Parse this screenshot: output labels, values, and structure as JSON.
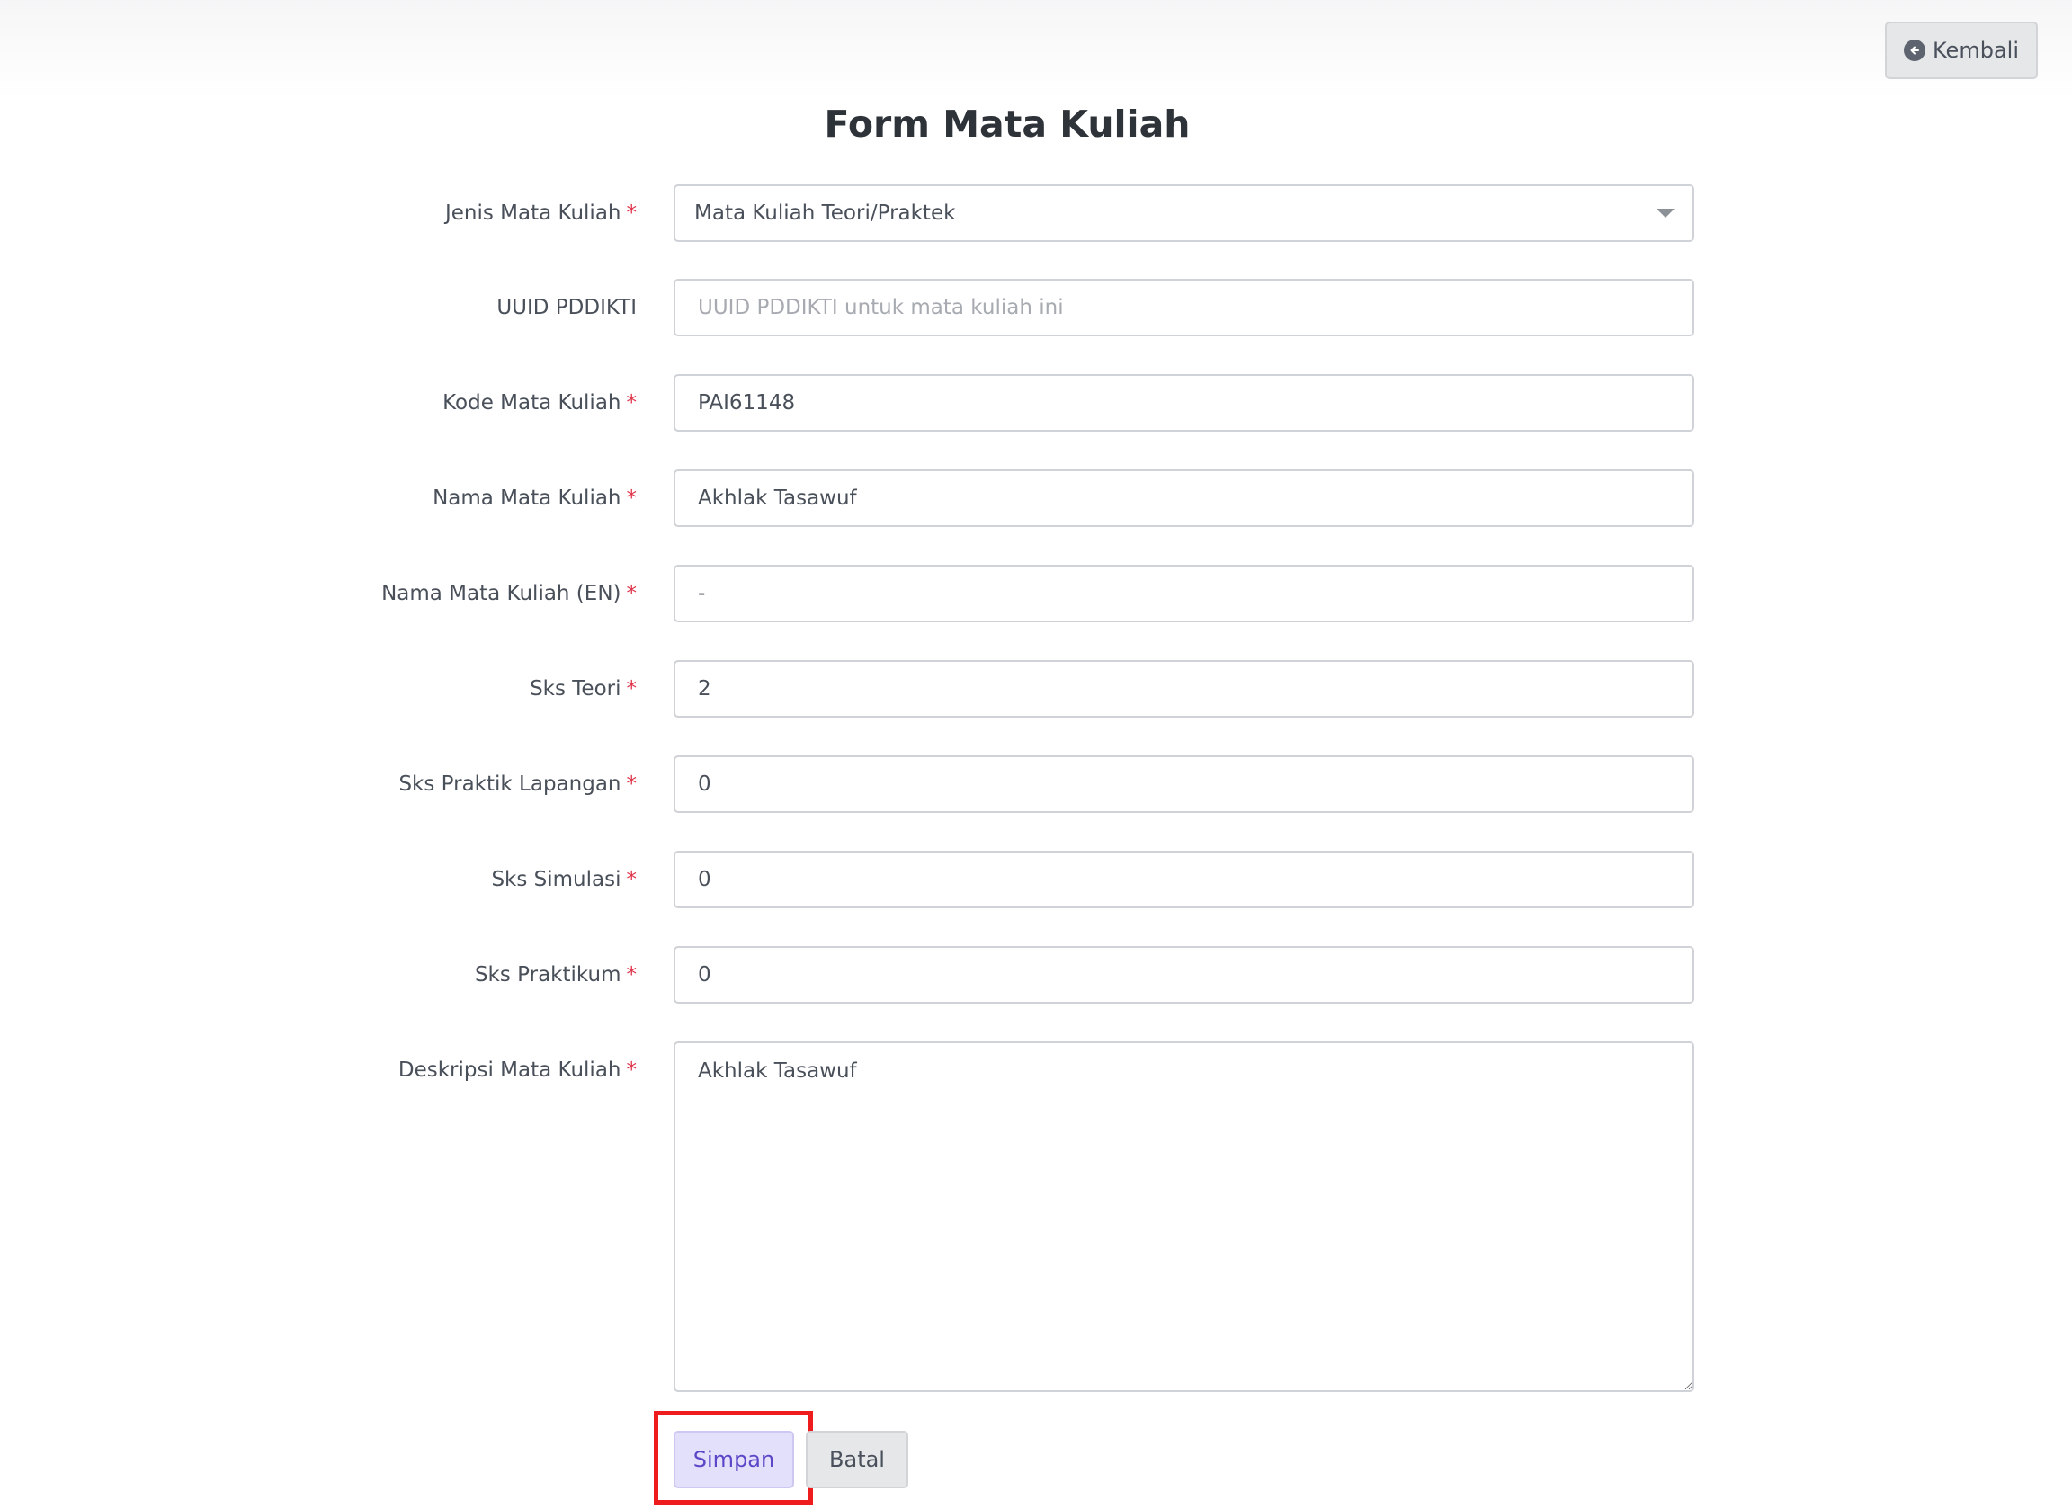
{
  "header": {
    "back_label": "Kembali",
    "back_icon": "arrow-left-circle-icon"
  },
  "page": {
    "title": "Form Mata Kuliah"
  },
  "required_mark": "*",
  "form": {
    "jenis": {
      "label": "Jenis Mata Kuliah",
      "value": "Mata Kuliah Teori/Praktek"
    },
    "uuid": {
      "label": "UUID PDDIKTI",
      "value": "",
      "placeholder": "UUID PDDIKTI untuk mata kuliah ini"
    },
    "kode": {
      "label": "Kode Mata Kuliah",
      "value": "PAI61148"
    },
    "nama": {
      "label": "Nama Mata Kuliah",
      "value": "Akhlak Tasawuf"
    },
    "nama_en": {
      "label": "Nama Mata Kuliah (EN)",
      "value": "-"
    },
    "sks_teori": {
      "label": "Sks Teori",
      "value": "2"
    },
    "sks_praktik_lapangan": {
      "label": "Sks Praktik Lapangan",
      "value": "0"
    },
    "sks_simulasi": {
      "label": "Sks Simulasi",
      "value": "0"
    },
    "sks_praktikum": {
      "label": "Sks Praktikum",
      "value": "0"
    },
    "deskripsi": {
      "label": "Deskripsi Mata Kuliah",
      "value": "Akhlak Tasawuf"
    }
  },
  "actions": {
    "save_label": "Simpan",
    "cancel_label": "Batal"
  },
  "colors": {
    "accent": "#5b46c7",
    "required": "#e0364c",
    "highlight": "#ee1c1c"
  }
}
